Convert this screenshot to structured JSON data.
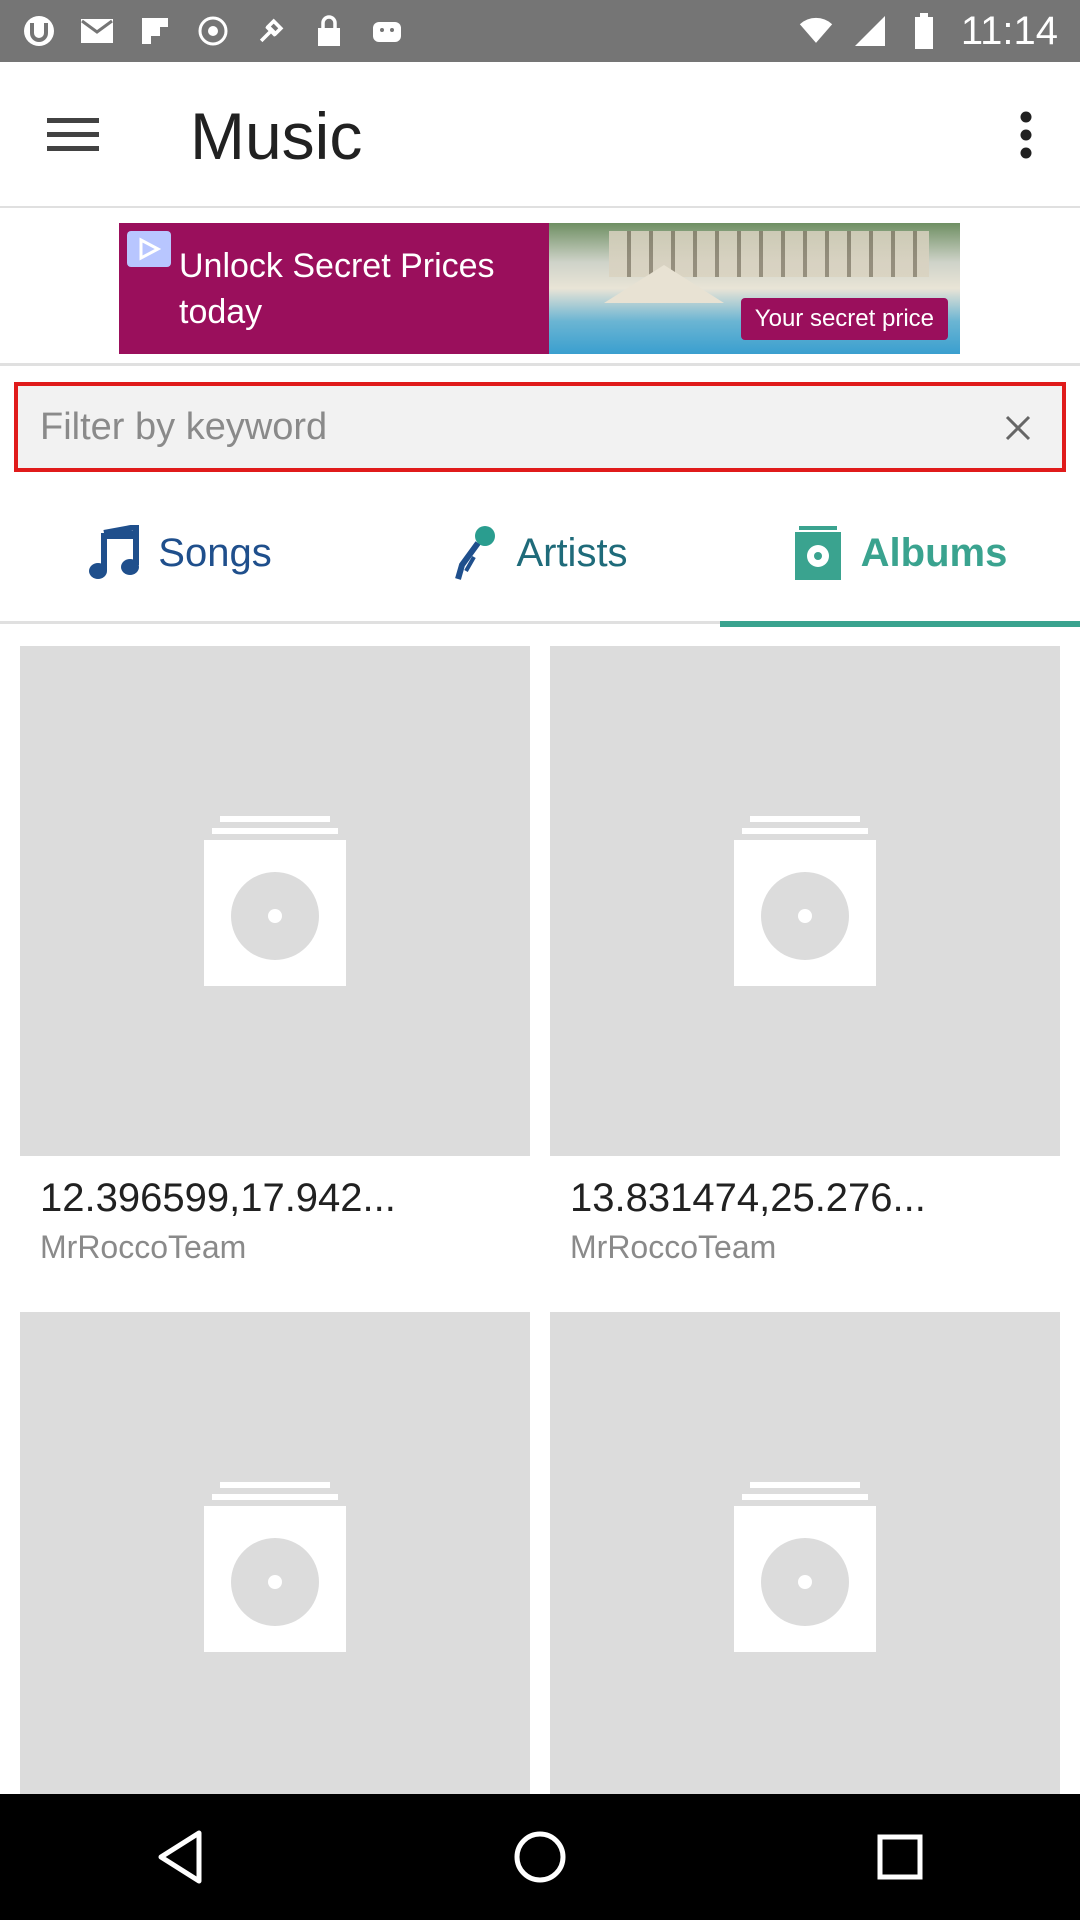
{
  "status_bar": {
    "time": "11:14",
    "icons": [
      "utorrent-icon",
      "mail-icon",
      "flipboard-icon",
      "vpn-icon",
      "fake-gps-icon",
      "lock-icon",
      "android-icon"
    ]
  },
  "app_bar": {
    "title": "Music"
  },
  "ad": {
    "headline": "Unlock Secret Prices today",
    "cta": "Your secret price"
  },
  "filter": {
    "placeholder": "Filter by keyword",
    "value": ""
  },
  "tabs": [
    {
      "label": "Songs",
      "icon": "music-note-icon",
      "active": false
    },
    {
      "label": "Artists",
      "icon": "microphone-icon",
      "active": false
    },
    {
      "label": "Albums",
      "icon": "album-icon",
      "active": true
    }
  ],
  "albums": [
    {
      "title": "12.396599,17.942...",
      "artist": "MrRoccoTeam"
    },
    {
      "title": "13.831474,25.276...",
      "artist": "MrRoccoTeam"
    },
    {
      "title": "",
      "artist": ""
    },
    {
      "title": "",
      "artist": ""
    }
  ],
  "colors": {
    "status_bar": "#757575",
    "accent": "#3aa38f",
    "filter_border": "#e01b1b",
    "ad_background": "#9a0f5c"
  }
}
